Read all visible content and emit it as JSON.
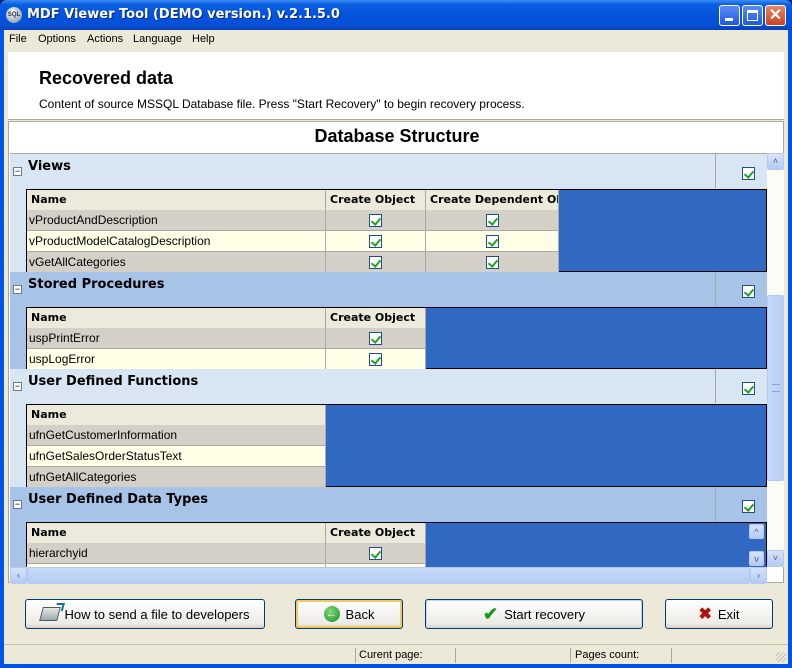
{
  "window": {
    "title": "MDF Viewer Tool (DEMO version.) v.2.1.5.0",
    "icon": "sql-app-icon",
    "controls": [
      "minimize",
      "maximize",
      "close"
    ]
  },
  "menu": [
    "File",
    "Options",
    "Actions",
    "Language",
    "Help"
  ],
  "header": {
    "title": "Recovered data",
    "subtitle": "Content of source MSSQL Database file. Press \"Start Recovery\" to begin recovery process."
  },
  "db_structure": {
    "title": "Database Structure",
    "sections": [
      {
        "title": "Views",
        "checked": true,
        "columns": [
          "Name",
          "Create Object",
          "Create Dependent Obj"
        ],
        "rows": [
          {
            "name": "vProductAndDescription",
            "create_object": true,
            "create_dependent": true
          },
          {
            "name": "vProductModelCatalogDescription",
            "create_object": true,
            "create_dependent": true
          },
          {
            "name": "vGetAllCategories",
            "create_object": true,
            "create_dependent": true
          }
        ]
      },
      {
        "title": "Stored Procedures",
        "checked": true,
        "columns": [
          "Name",
          "Create Object"
        ],
        "rows": [
          {
            "name": "uspPrintError",
            "create_object": true
          },
          {
            "name": "uspLogError",
            "create_object": true
          }
        ]
      },
      {
        "title": "User Defined Functions",
        "checked": true,
        "columns": [
          "Name"
        ],
        "rows": [
          {
            "name": "ufnGetCustomerInformation"
          },
          {
            "name": "ufnGetSalesOrderStatusText"
          },
          {
            "name": "ufnGetAllCategories"
          }
        ]
      },
      {
        "title": "User Defined Data Types",
        "checked": true,
        "columns": [
          "Name",
          "Create Object"
        ],
        "rows": [
          {
            "name": "hierarchyid",
            "create_object": true
          }
        ]
      }
    ]
  },
  "buttons": {
    "send_file": "How to send a file to developers",
    "back": "Back",
    "start": "Start recovery",
    "exit": "Exit"
  },
  "status": {
    "current_page_label": "Curent page:",
    "current_page_value": "",
    "pages_count_label": "Pages count:",
    "pages_count_value": ""
  },
  "colors": {
    "table_bg": "#3168c2",
    "section_light": "#d8e6f4",
    "section_dark": "#a7c4e8",
    "row_alt": "#ffffe7"
  }
}
